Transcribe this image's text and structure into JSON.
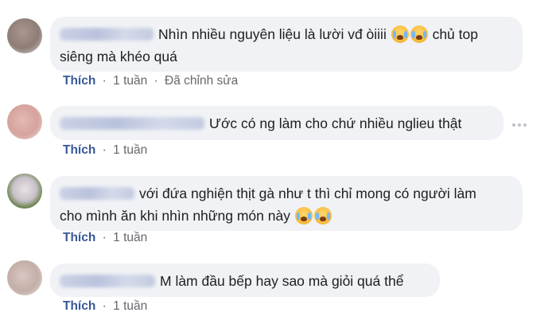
{
  "comments": [
    {
      "text_line1": "Nhìn nhiều nguyên liệu là lười vđ òiiii",
      "emojis_line1": [
        "crying-face-emoji",
        "crying-face-emoji"
      ],
      "text_line1_tail": "chủ top",
      "text_line2": "siêng mà khéo quá",
      "meta": {
        "like": "Thích",
        "time": "1 tuần",
        "extra": "Đã chỉnh sửa"
      }
    },
    {
      "text_line1": "Ước có ng làm cho chứ nhiều nglieu thật",
      "meta": {
        "like": "Thích",
        "time": "1 tuần"
      }
    },
    {
      "text_line1": "với đứa nghiện thịt gà như t thì chỉ mong có người làm",
      "text_line2": "cho mình ăn khi nhìn những món này",
      "emojis_line2": [
        "crying-face-emoji",
        "crying-face-emoji"
      ],
      "meta": {
        "like": "Thích",
        "time": "1 tuần"
      }
    },
    {
      "text_line1": "M làm đầu bếp hay sao mà giỏi quá thể",
      "meta": {
        "like": "Thích",
        "time": "1 tuần"
      }
    }
  ],
  "separator": "·",
  "colors": {
    "bubble": "#f0f2f5",
    "like": "#385898",
    "meta": "#65676b"
  }
}
